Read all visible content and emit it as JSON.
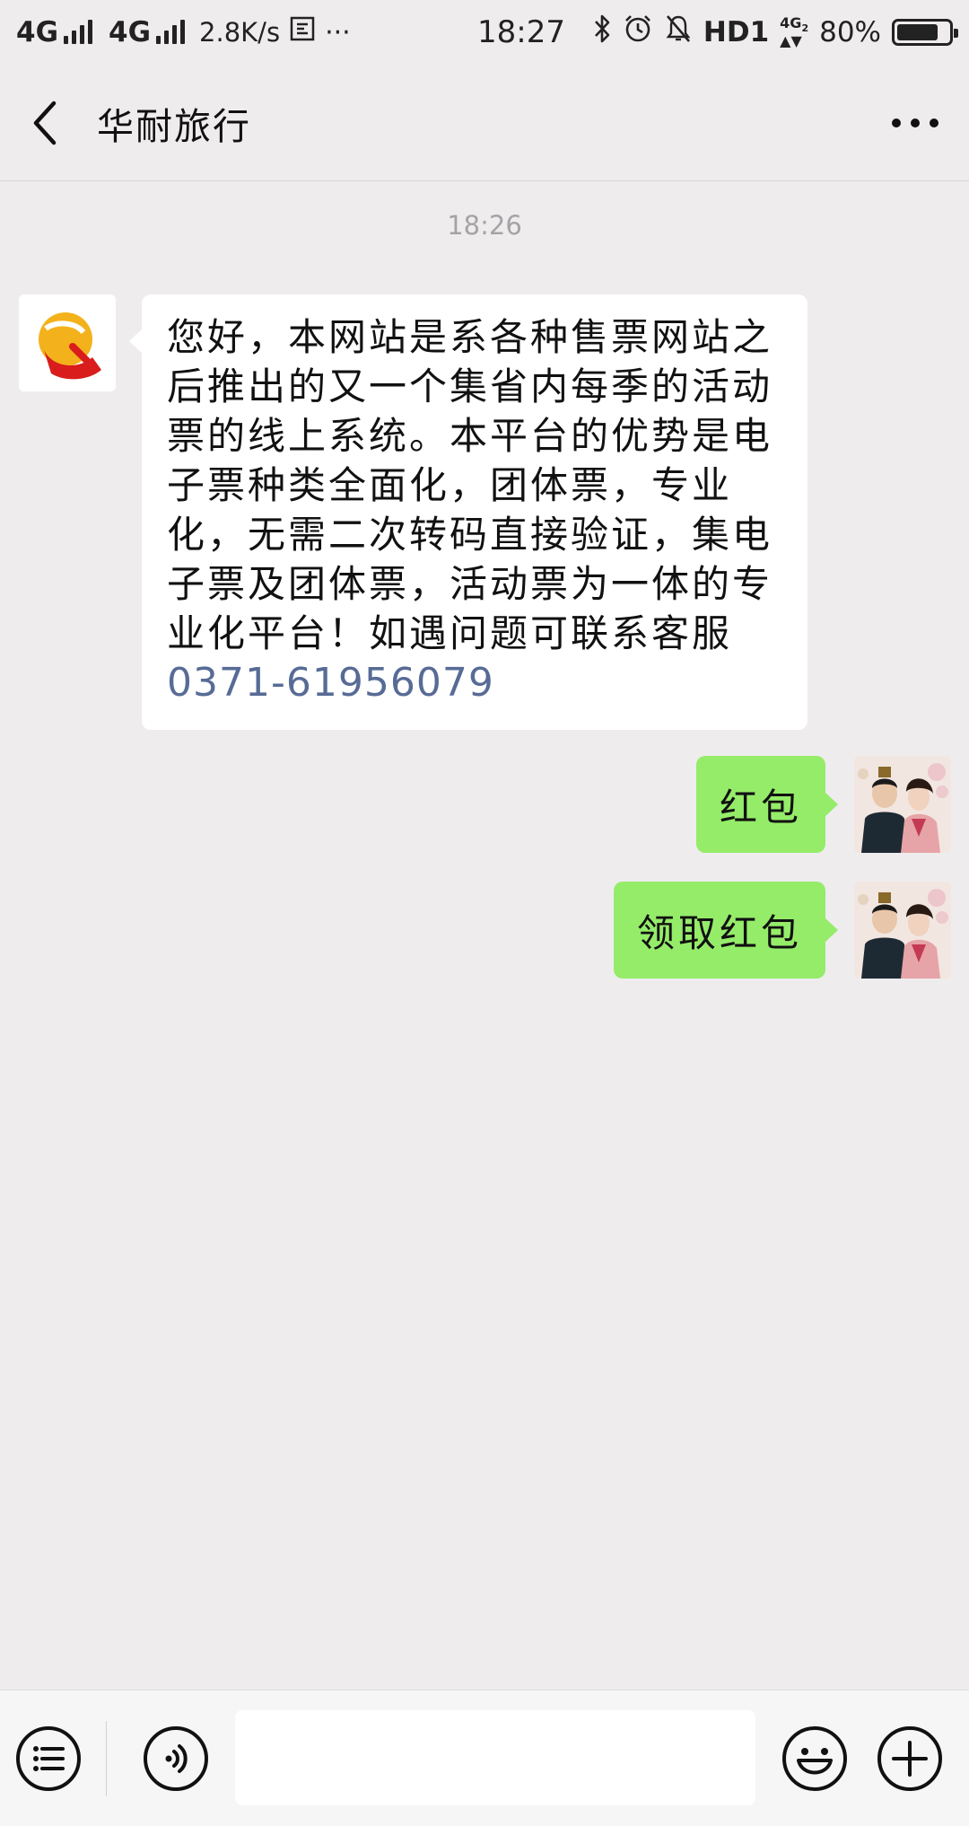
{
  "status_bar": {
    "network_1": "4G",
    "network_2": "4G",
    "speed": "2.8K/s",
    "time": "18:27",
    "hd": "HD1",
    "battery_percent": "80%",
    "battery_level": 0.8
  },
  "header": {
    "title": "华耐旅行"
  },
  "chat": {
    "timestamp": "18:26",
    "messages": [
      {
        "direction": "incoming",
        "text": "您好，本网站是系各种售票网站之后推出的又一个集省内每季的活动票的线上系统。本平台的优势是电子票种类全面化，团体票，专业化，无需二次转码直接验证，集电子票及团体票，活动票为一体的专业化平台！如遇问题可联系客服",
        "phone": "0371-61956079"
      },
      {
        "direction": "outgoing",
        "text": "红包"
      },
      {
        "direction": "outgoing",
        "text": "领取红包"
      }
    ]
  },
  "input_bar": {
    "icons": [
      "menu-list-icon",
      "voice-icon",
      "emoji-icon",
      "plus-icon"
    ],
    "input_value": ""
  },
  "colors": {
    "background": "#EFECEE",
    "outgoing_bubble": "#95EC69",
    "incoming_bubble": "#FFFFFF",
    "link": "#576B95"
  }
}
